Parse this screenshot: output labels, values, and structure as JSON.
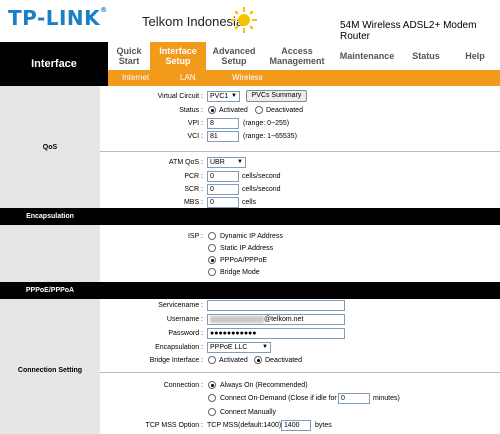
{
  "header": {
    "brand": "TP-LINK",
    "partner": "Telkom Indonesia",
    "model": "54M Wireless ADSL2+ Modem Router"
  },
  "nav": {
    "title": "Interface",
    "items": [
      "Quick Start",
      "Interface Setup",
      "Advanced Setup",
      "Access Management",
      "Maintenance",
      "Status",
      "Help"
    ],
    "active": "Interface Setup",
    "subitems": [
      "Internet",
      "LAN",
      "Wireless"
    ]
  },
  "sections": {
    "qos": "QoS",
    "encapsulation": "Encapsulation",
    "pppoe": "PPPoE/PPPoA",
    "connection": "Connection Setting"
  },
  "form": {
    "virtual_circuit": {
      "label": "Virtual Circuit :",
      "value": "PVC1",
      "button": "PVCs Summary"
    },
    "status": {
      "label": "Status :",
      "options": [
        "Activated",
        "Deactivated"
      ],
      "selected": "Activated"
    },
    "vpi": {
      "label": "VPI :",
      "value": "8",
      "hint": "(range: 0~255)"
    },
    "vci": {
      "label": "VCI :",
      "value": "81",
      "hint": "(range: 1~65535)"
    },
    "atm_qos": {
      "label": "ATM QoS :",
      "value": "UBR"
    },
    "pcr": {
      "label": "PCR :",
      "value": "0",
      "unit": "cells/second"
    },
    "scr": {
      "label": "SCR :",
      "value": "0",
      "unit": "cells/second"
    },
    "mbs": {
      "label": "MBS :",
      "value": "0",
      "unit": "cells"
    },
    "isp": {
      "label": "ISP :",
      "options": [
        "Dynamic IP Address",
        "Static IP Address",
        "PPPoA/PPPoE",
        "Bridge Mode"
      ],
      "selected": "PPPoA/PPPoE"
    },
    "servicename": {
      "label": "Servicename :",
      "value": ""
    },
    "username": {
      "label": "Username :",
      "suffix": "@telkom.net"
    },
    "password": {
      "label": "Password :",
      "value": "●●●●●●●●●●●"
    },
    "encap": {
      "label": "Encapsulation :",
      "value": "PPPoE LLC"
    },
    "bridge_interface": {
      "label": "Bridge Interface :",
      "options": [
        "Activated",
        "Deactivated"
      ],
      "selected": "Deactivated"
    },
    "connection": {
      "label": "Connection :",
      "always_on": "Always On (Recommended)",
      "on_demand_pre": "Connect On-Demand (Close if idle for",
      "on_demand_value": "0",
      "on_demand_post": "minutes)",
      "manual": "Connect Manually",
      "selected": "always_on"
    },
    "tcp_mss": {
      "label": "TCP MSS Option :",
      "text": "TCP MSS(default:1400)",
      "value": "1400",
      "unit": "bytes"
    }
  }
}
